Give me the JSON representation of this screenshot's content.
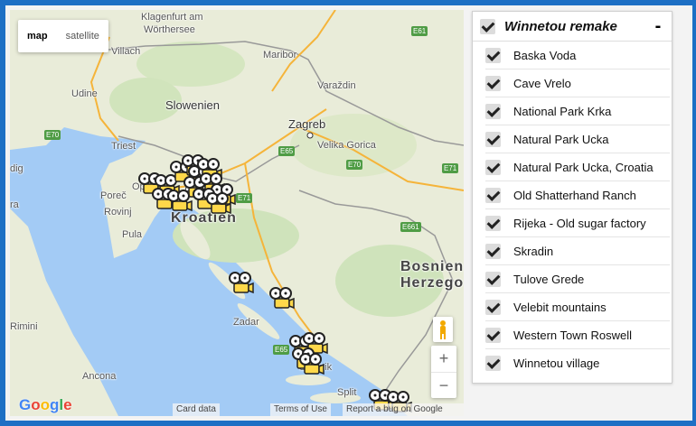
{
  "map": {
    "type_control": {
      "map_label": "map",
      "satellite_label": "satellite"
    },
    "labels": {
      "klagenfurt": "Klagenfurt am",
      "worthersee": "Wörthersee",
      "villach": "Villach",
      "maribor": "Maribor",
      "udine": "Udine",
      "slowenien": "Slowenien",
      "varazdin": "Varaždin",
      "zagreb": "Zagreb",
      "velika_gorica": "Velika Gorica",
      "triest": "Triest",
      "porec": "Poreč",
      "rovinj": "Rovinj",
      "pula": "Pula",
      "kroatien": "Kroatien",
      "bosnien": "Bosnien",
      "herzego": "Herzego",
      "zadar": "Zadar",
      "rimini": "Rimini",
      "sibenik": "Šibenik",
      "ancona": "Ancona",
      "split": "Split",
      "dig": "dig",
      "ra": "ra",
      "op": "Op",
      "ri": "Ri"
    },
    "shields": {
      "e61": "E61",
      "e71a": "E71",
      "e70a": "E70",
      "e65a": "E65",
      "e70b": "E70",
      "e71b": "E71",
      "e661": "E661",
      "e65b": "E65"
    },
    "zoom_in": "+",
    "zoom_out": "−",
    "google_logo": "Google",
    "attribution": {
      "card_data": "Card data",
      "terms": "Terms of Use",
      "report": "Report a bug on Google Maps"
    }
  },
  "legend": {
    "title": "Winnetou remake",
    "collapse_symbol": "-",
    "items": [
      "Baska Voda",
      "Cave Vrelo",
      "National Park Krka",
      "Natural Park Ucka",
      "Natural Park Ucka, Croatia",
      "Old Shatterhand Ranch",
      "Rijeka - Old sugar factory",
      "Skradin",
      "Tulove Grede",
      "Velebit mountains",
      "Western Town Roswell",
      "Winnetou village"
    ]
  },
  "colors": {
    "sea": "#a3cbf5",
    "land": "#e9ecd9",
    "marker": "#ffd84a",
    "frame": "#1d6fc4"
  }
}
